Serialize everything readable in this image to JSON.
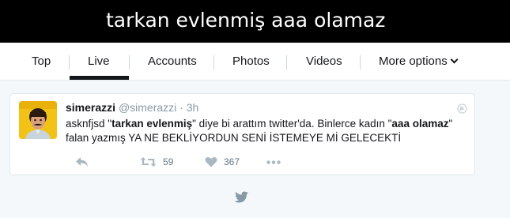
{
  "search": {
    "query": "tarkan evlenmiş aaa olamaz"
  },
  "tabs": [
    {
      "label": "Top"
    },
    {
      "label": "Live"
    },
    {
      "label": "Accounts"
    },
    {
      "label": "Photos"
    },
    {
      "label": "Videos"
    },
    {
      "label": "More options"
    }
  ],
  "active_tab": "Live",
  "tweet": {
    "name": "simerazzi",
    "handle": "@simerazzi",
    "separator": "·",
    "time": "3h",
    "text_parts": [
      "asknfjsd \"",
      "tarkan evlenmiş",
      "\" diye bi arattım twitter'da. Binlerce kadın \"",
      "aaa olamaz",
      "\" falan yazmış YA NE BEKLİYORDUN SENİ İSTEMEYE Mİ GELECEKTİ"
    ],
    "retweets": "59",
    "likes": "367"
  },
  "colors": {
    "header_bg": "#000000",
    "tab_underline": "#14171a",
    "icon_grey": "#aab8c2",
    "bird": "#8899a6"
  },
  "icons": {
    "reply": "reply-icon",
    "retweet": "retweet-icon",
    "like": "heart-icon",
    "more": "more-dots-icon",
    "globe": "globe-icon",
    "bird": "twitter-bird-icon"
  }
}
